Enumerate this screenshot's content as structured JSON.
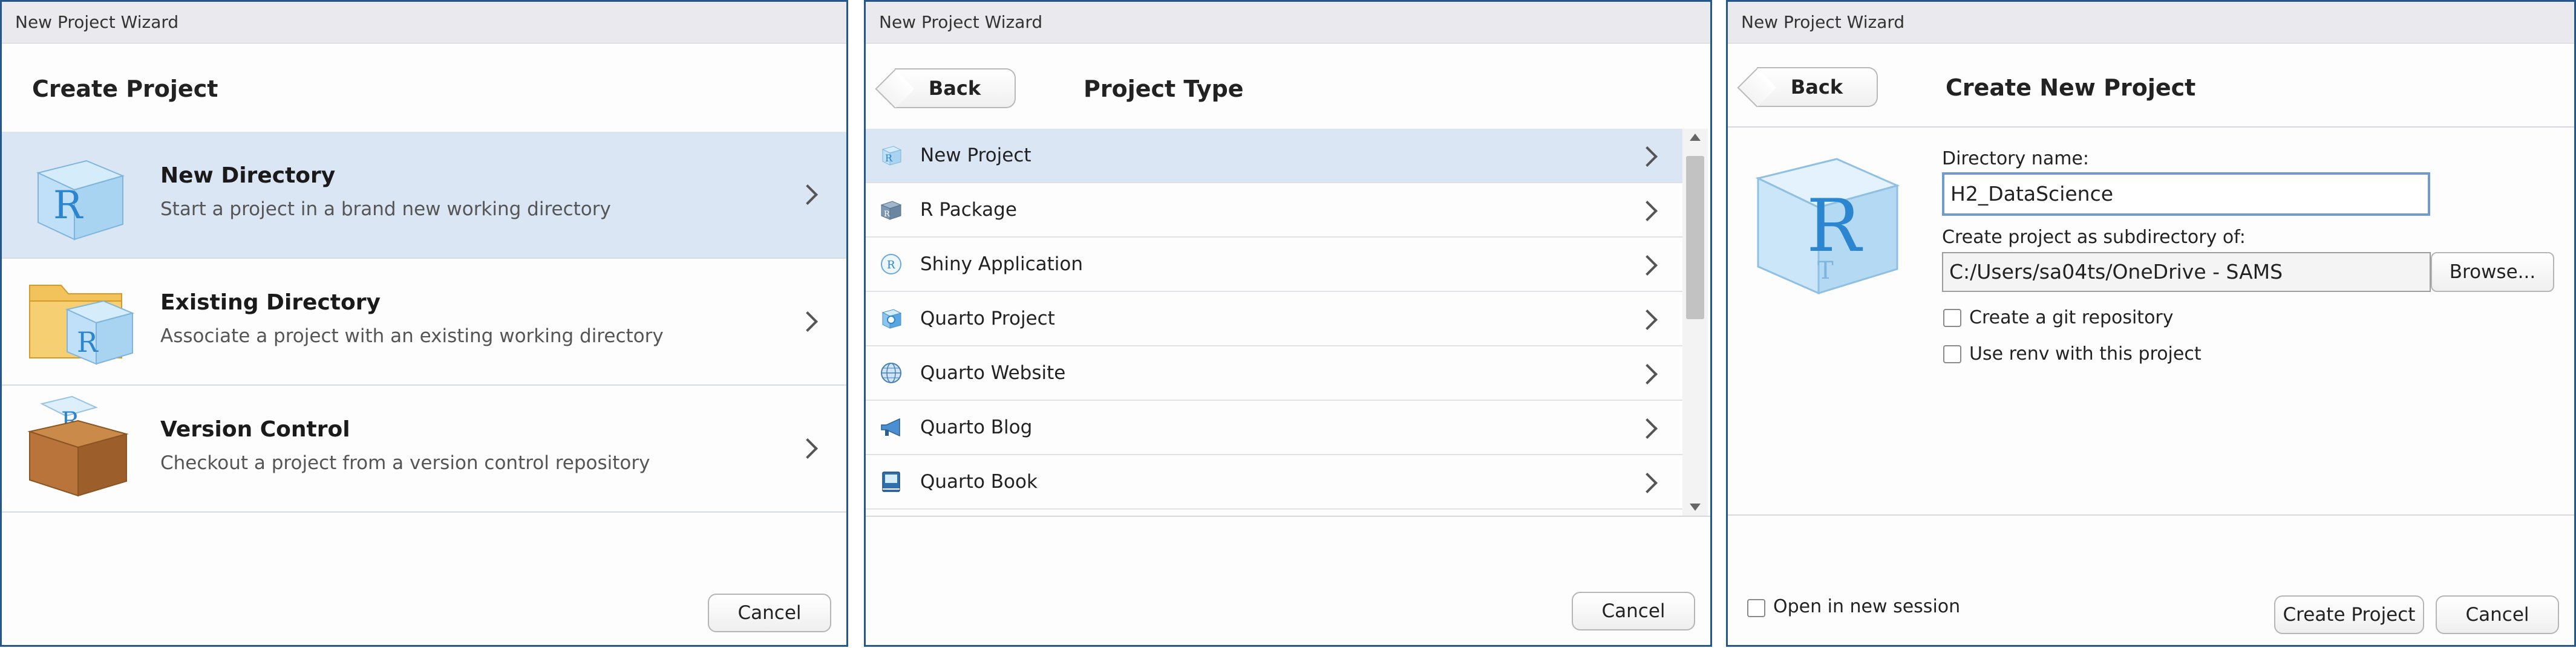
{
  "window1": {
    "title": "New Project Wizard",
    "heading": "Create Project",
    "options": [
      {
        "title": "New Directory",
        "subtitle": "Start a project in a brand new working directory",
        "icon": "r-cube-icon",
        "selected": true
      },
      {
        "title": "Existing Directory",
        "subtitle": "Associate a project with an existing working directory",
        "icon": "folder-r-icon",
        "selected": false
      },
      {
        "title": "Version Control",
        "subtitle": "Checkout a project from a version control repository",
        "icon": "box-icon",
        "selected": false
      }
    ],
    "cancel_label": "Cancel"
  },
  "window2": {
    "title": "New Project Wizard",
    "back_label": "Back",
    "heading": "Project Type",
    "items": [
      {
        "label": "New Project",
        "icon": "r-cube-icon",
        "selected": true
      },
      {
        "label": "R Package",
        "icon": "package-icon"
      },
      {
        "label": "Shiny Application",
        "icon": "shiny-icon"
      },
      {
        "label": "Quarto Project",
        "icon": "quarto-icon"
      },
      {
        "label": "Quarto Website",
        "icon": "globe-icon"
      },
      {
        "label": "Quarto Blog",
        "icon": "megaphone-icon"
      },
      {
        "label": "Quarto Book",
        "icon": "book-icon"
      }
    ],
    "cancel_label": "Cancel"
  },
  "window3": {
    "title": "New Project Wizard",
    "back_label": "Back",
    "heading": "Create New Project",
    "dir_name_label": "Directory name:",
    "dir_name_value": "H2_DataScience",
    "subdir_label": "Create project as subdirectory of:",
    "subdir_value": "C:/Users/sa04ts/OneDrive - SAMS",
    "browse_label": "Browse...",
    "git_label": "Create a git repository",
    "git_checked": false,
    "renv_label": "Use renv with this project",
    "renv_checked": false,
    "new_session_label": "Open in new session",
    "new_session_checked": false,
    "create_label": "Create Project",
    "cancel_label": "Cancel"
  },
  "colors": {
    "border": "#26578a",
    "selection": "#dbe6f4",
    "focus": "#6f9ad3"
  }
}
